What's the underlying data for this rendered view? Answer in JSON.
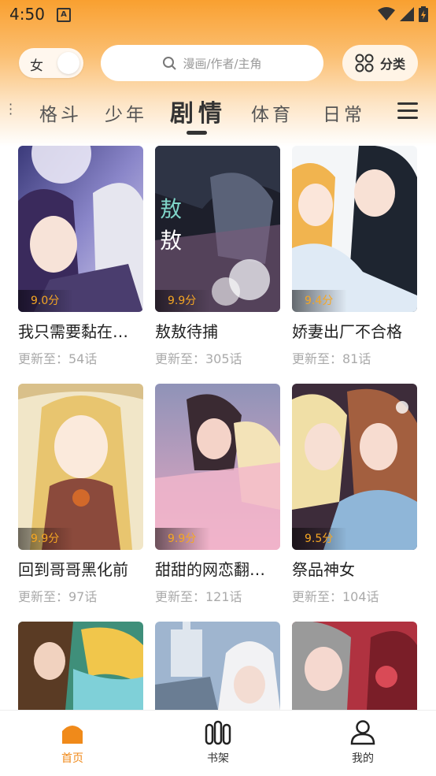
{
  "status_bar": {
    "time": "4:50",
    "app_icon_letter": "A"
  },
  "top": {
    "gender_label": "女",
    "search_placeholder": "漫画/作者/主角",
    "category_label": "分类"
  },
  "tabs": [
    {
      "label": "格斗",
      "active": false
    },
    {
      "label": "少年",
      "active": false
    },
    {
      "label": "剧情",
      "active": true
    },
    {
      "label": "体育",
      "active": false
    },
    {
      "label": "日常",
      "active": false
    }
  ],
  "comics": [
    {
      "title": "我只需要黏在…",
      "score": "9.0分",
      "update": "更新至：54话"
    },
    {
      "title": "敖敖待捕",
      "score": "9.9分",
      "update": "更新至：305话"
    },
    {
      "title": "娇妻出厂不合格",
      "score": "9.4分",
      "update": "更新至：81话"
    },
    {
      "title": "回到哥哥黑化前",
      "score": "9.9分",
      "update": "更新至：97话"
    },
    {
      "title": "甜甜的网恋翻…",
      "score": "9.9分",
      "update": "更新至：121话"
    },
    {
      "title": "祭品神女",
      "score": "9.5分",
      "update": "更新至：104话"
    }
  ],
  "bottom_nav": [
    {
      "label": "首页",
      "icon": "home-icon",
      "active": true
    },
    {
      "label": "书架",
      "icon": "bookshelf-icon",
      "active": false
    },
    {
      "label": "我的",
      "icon": "profile-icon",
      "active": false
    }
  ],
  "colors": {
    "accent": "#f08a1a",
    "header_top": "#f9a030",
    "score": "#f5a623"
  }
}
